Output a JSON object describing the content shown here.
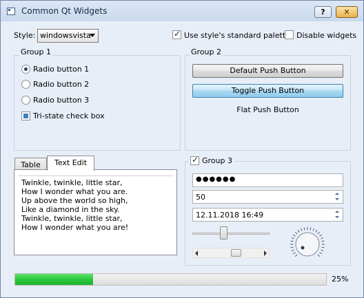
{
  "window": {
    "title": "Common Qt Widgets",
    "help_label": "?",
    "close_label": "✕"
  },
  "top": {
    "style_label": "Style:",
    "style_value": "windowsvista",
    "standard_palette_label": "Use style's standard palette",
    "standard_palette_checked": true,
    "disable_widgets_label": "Disable widgets",
    "disable_widgets_checked": false
  },
  "group1": {
    "title": "Group 1",
    "radios": [
      {
        "label": "Radio button 1",
        "checked": true
      },
      {
        "label": "Radio button 2",
        "checked": false
      },
      {
        "label": "Radio button 3",
        "checked": false
      }
    ],
    "tristate_label": "Tri-state check box"
  },
  "group2": {
    "title": "Group 2",
    "default_button": "Default Push Button",
    "toggle_button": "Toggle Push Button",
    "flat_button": "Flat Push Button"
  },
  "tabs": {
    "items": [
      {
        "label": "Table",
        "active": false
      },
      {
        "label": "Text Edit",
        "active": true
      }
    ],
    "text_lines": [
      "Twinkle, twinkle, little star,",
      "How I wonder what you are.",
      "Up above the world so high,",
      "Like a diamond in the sky.",
      "Twinkle, twinkle, little star,",
      "How I wonder what you are!"
    ]
  },
  "group3": {
    "title": "Group 3",
    "checked": true,
    "password_value": "●●●●●●",
    "spin_value": "50",
    "datetime_value": "12.11.2018 16:49"
  },
  "progress": {
    "value": 0.25,
    "label": "25%"
  },
  "colors": {
    "accent": "#3c7fb1",
    "progress": "#28c83a"
  }
}
